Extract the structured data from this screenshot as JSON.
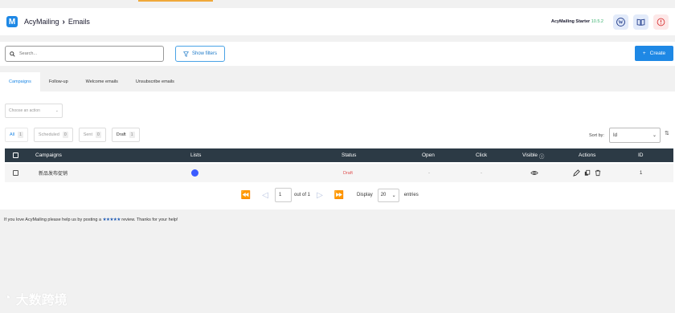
{
  "header": {
    "brand": "AcyMailing",
    "crumb": "Emails",
    "version_label": "AcyMailing Starter",
    "version_num": "10.5.2"
  },
  "toolbar": {
    "search_placeholder": "Search...",
    "show_filters": "Show filters",
    "create": "Create"
  },
  "tabs": [
    {
      "label": "Campaigns",
      "active": true
    },
    {
      "label": "Follow-up",
      "active": false
    },
    {
      "label": "Welcome emails",
      "active": false
    },
    {
      "label": "Unsubscribe emails",
      "active": false
    }
  ],
  "bulk_action": "Choose an action",
  "status_filters": [
    {
      "label": "All",
      "count": "1"
    },
    {
      "label": "Scheduled",
      "count": "0"
    },
    {
      "label": "Sent",
      "count": "0"
    },
    {
      "label": "Draft",
      "count": "1"
    }
  ],
  "sort": {
    "label": "Sort by:",
    "value": "Id"
  },
  "table": {
    "headers": {
      "campaigns": "Campaigns",
      "lists": "Lists",
      "status": "Status",
      "open": "Open",
      "click": "Click",
      "visible": "Visible",
      "actions": "Actions",
      "id": "ID"
    },
    "rows": [
      {
        "name": "新品发布促销",
        "list_color": "#3b5bff",
        "status": "Draft",
        "open": "-",
        "click": "-",
        "id": "1"
      }
    ]
  },
  "pagination": {
    "page": "1",
    "of_label": "out of 1",
    "display_label": "Display",
    "per_page": "20",
    "entries_label": "entries"
  },
  "footer": {
    "text_before": "If you love AcyMailing please help us by posting a",
    "stars": "★★★★★",
    "text_after": "review. Thanks for your help!"
  },
  "watermark": "大数跨境",
  "colors": {
    "accent": "#1e88e5",
    "table_header": "#2c3a45",
    "draft": "#e05050"
  }
}
